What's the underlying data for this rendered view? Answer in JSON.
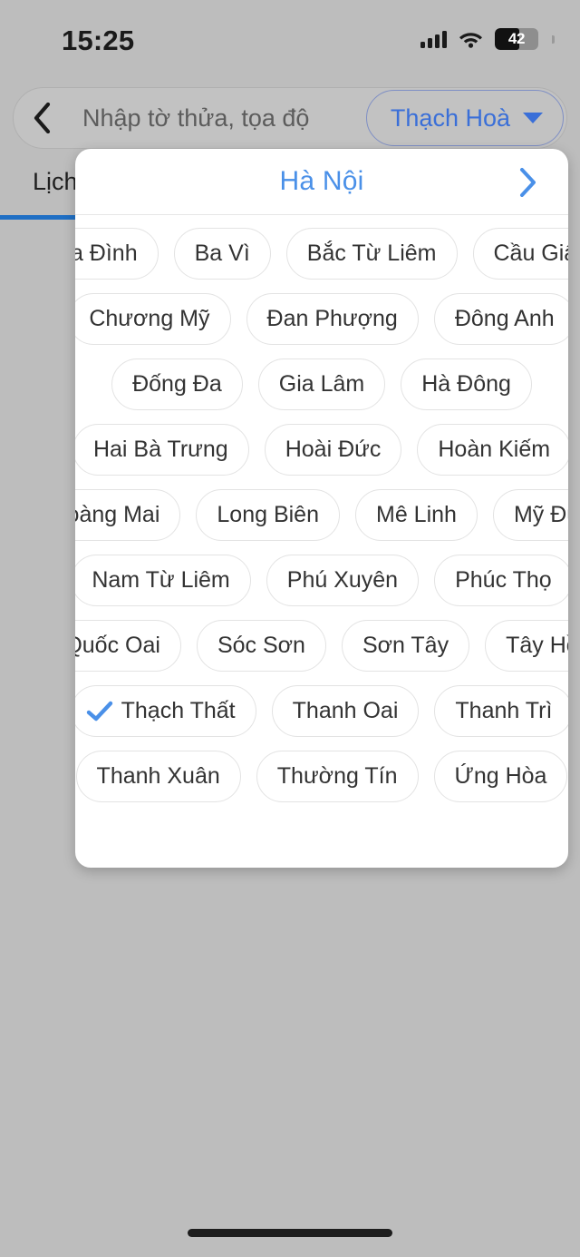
{
  "status_bar": {
    "time": "15:25",
    "signal_icon": "cellular-signal-icon",
    "wifi_icon": "wifi-icon",
    "battery_level": "42",
    "battery_icon": "battery-icon"
  },
  "search_bar": {
    "back_icon": "back-chevron-icon",
    "placeholder": "Nhập tờ thửa, tọa độ",
    "value": "",
    "district_selector": {
      "label": "Thạch Hoà",
      "caret_icon": "chevron-down-icon"
    }
  },
  "tabs": [
    {
      "label": "Lịch",
      "active": true
    }
  ],
  "panel": {
    "title": "Hà Nội",
    "next_icon": "chevron-right-icon",
    "check_icon": "check-icon",
    "selected": "Thạch Thất",
    "rows": [
      [
        "Ba Đình",
        "Ba Vì",
        "Bắc Từ Liêm",
        "Cầu Giấy"
      ],
      [
        "Chương Mỹ",
        "Đan Phượng",
        "Đông Anh"
      ],
      [
        "Đống Đa",
        "Gia Lâm",
        "Hà Đông"
      ],
      [
        "Hai Bà Trưng",
        "Hoài Đức",
        "Hoàn Kiếm"
      ],
      [
        "Hoàng Mai",
        "Long Biên",
        "Mê Linh",
        "Mỹ Đức"
      ],
      [
        "Nam Từ Liêm",
        "Phú Xuyên",
        "Phúc Thọ"
      ],
      [
        "Quốc Oai",
        "Sóc Sơn",
        "Sơn Tây",
        "Tây Hồ"
      ],
      [
        "Thạch Thất",
        "Thanh Oai",
        "Thanh Trì"
      ],
      [
        "Thanh Xuân",
        "Thường Tín",
        "Ứng Hòa"
      ]
    ]
  },
  "colors": {
    "accent_blue": "#4a90e8",
    "link_blue": "#3a6fd8",
    "tab_underline": "#1f6fc4",
    "background": "#bdbdbd",
    "panel_background": "#ffffff",
    "chip_border": "#e3e3e3"
  },
  "home_indicator": "home-indicator"
}
